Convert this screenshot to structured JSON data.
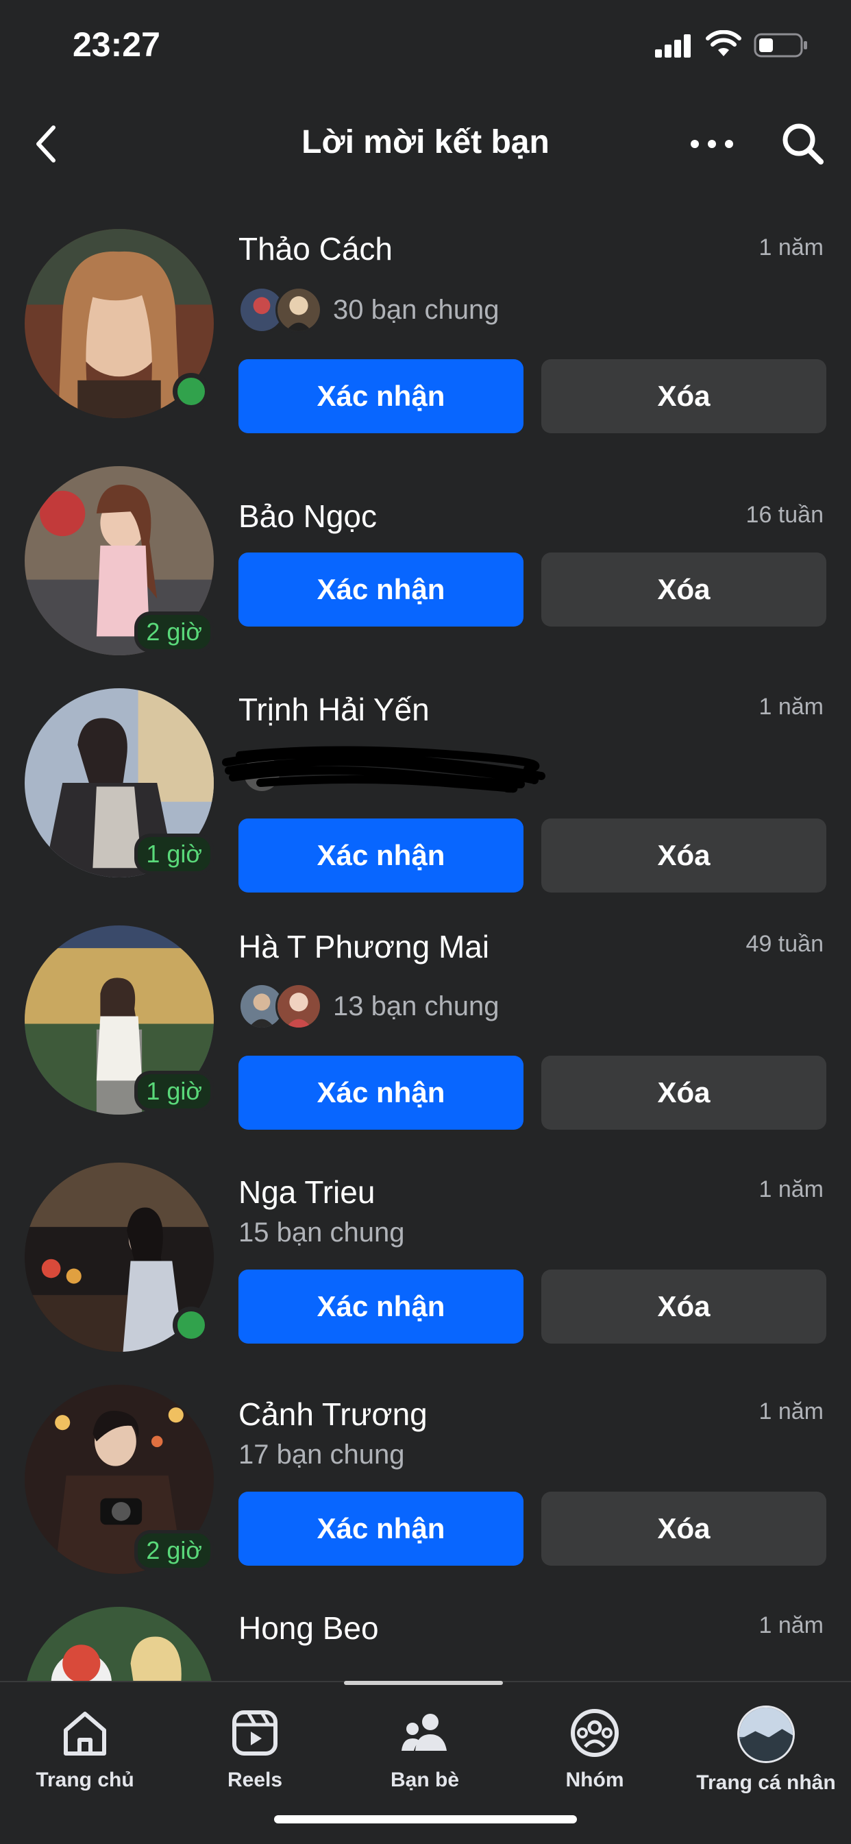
{
  "status_bar": {
    "time": "23:27"
  },
  "header": {
    "title": "Lời mời kết bạn"
  },
  "buttons": {
    "confirm": "Xác nhận",
    "delete": "Xóa"
  },
  "requests": [
    {
      "name": "Thảo Cách",
      "time": "1 năm",
      "mutual": "30 bạn chung",
      "status": "online"
    },
    {
      "name": "Bảo Ngọc",
      "time": "16 tuần",
      "active": "2 giờ"
    },
    {
      "name": "Trịnh Hải Yến",
      "time": "1 năm",
      "active": "1 giờ"
    },
    {
      "name": "Hà T Phương Mai",
      "time": "49 tuần",
      "mutual": "13 bạn chung",
      "active": "1 giờ"
    },
    {
      "name": "Nga Trieu",
      "time": "1 năm",
      "mutual": "15 bạn chung",
      "status": "online"
    },
    {
      "name": "Cảnh Trương",
      "time": "1 năm",
      "mutual": "17 bạn chung",
      "active": "2 giờ"
    },
    {
      "name": "Hong Beo",
      "time": "1 năm"
    }
  ],
  "tabs": [
    {
      "label": "Trang chủ",
      "icon": "home-icon"
    },
    {
      "label": "Reels",
      "icon": "reels-icon"
    },
    {
      "label": "Bạn bè",
      "icon": "friends-icon",
      "active": true
    },
    {
      "label": "Nhóm",
      "icon": "groups-icon"
    },
    {
      "label": "Trang cá nhân",
      "icon": "profile-avatar"
    }
  ],
  "colors": {
    "background": "#242526",
    "primary_button": "#0866ff",
    "secondary_button": "#3a3b3c",
    "online": "#31a24c"
  }
}
